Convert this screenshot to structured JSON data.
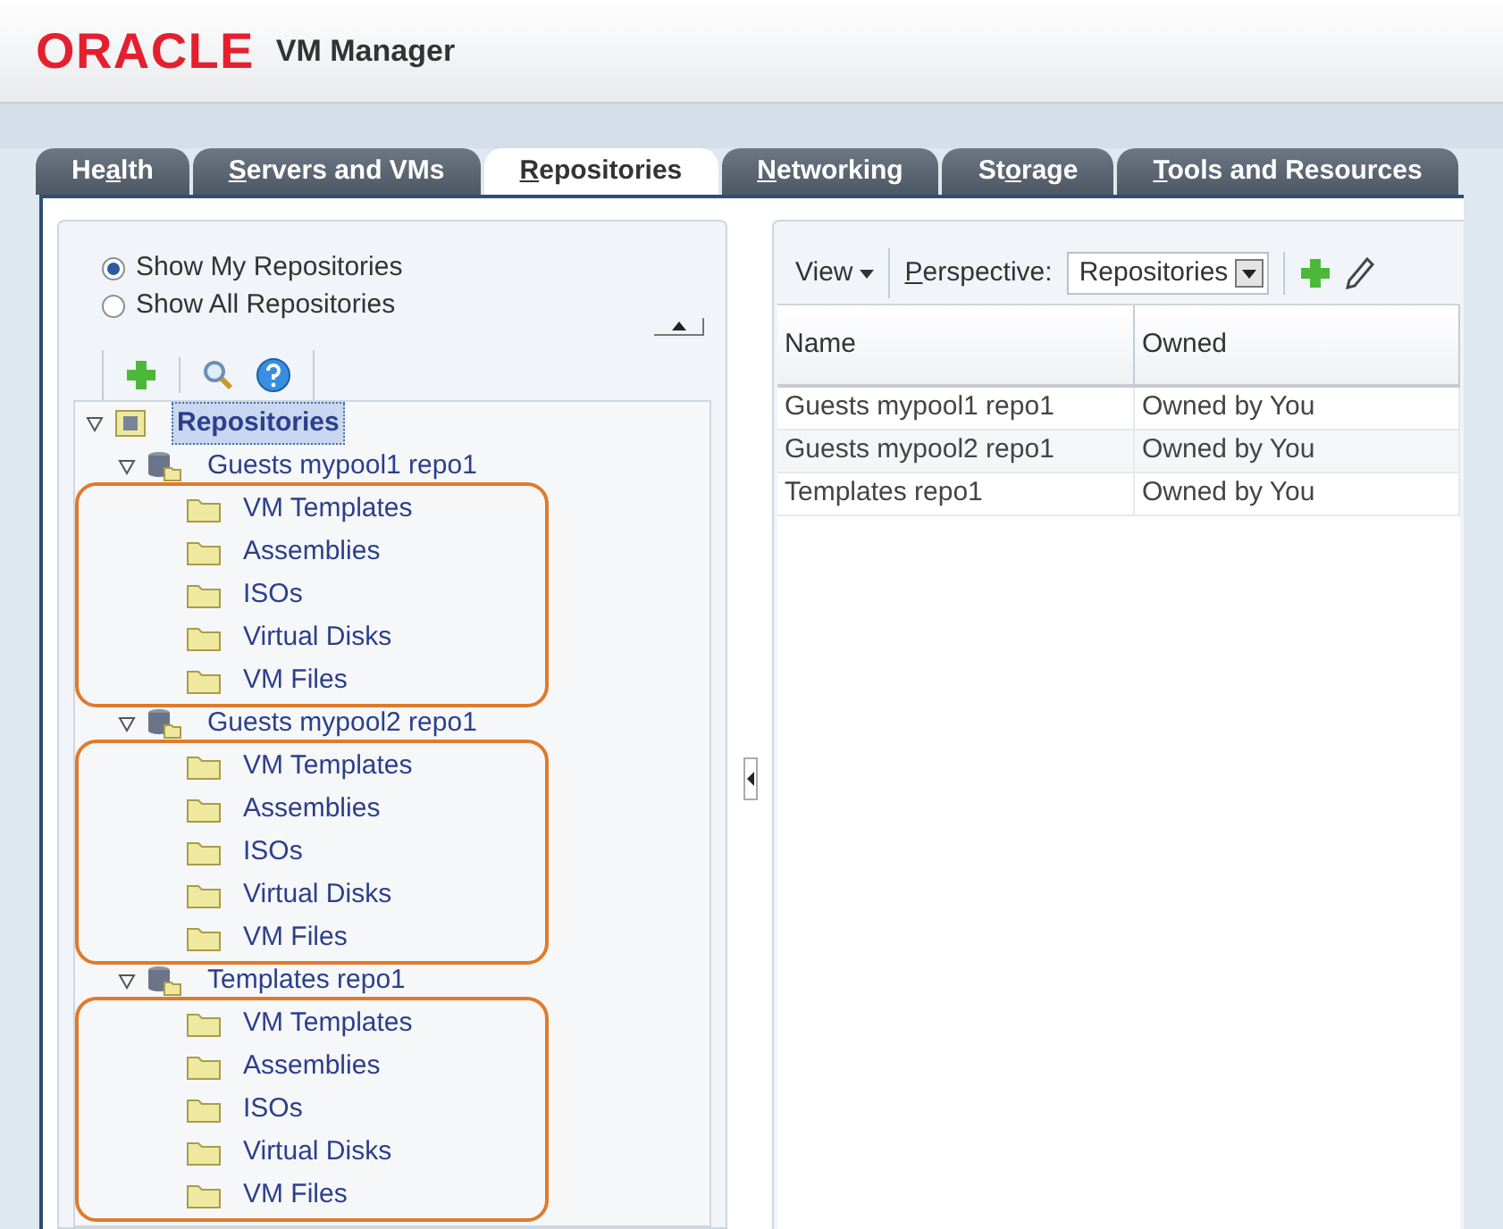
{
  "header": {
    "logo": "ORACLE",
    "title": "VM Manager"
  },
  "tabs": [
    {
      "label_parts": {
        "before": "He",
        "key": "a",
        "after": "lth"
      },
      "selected": false
    },
    {
      "label_parts": {
        "key": "S",
        "after": "ervers and VMs"
      },
      "selected": false
    },
    {
      "label_parts": {
        "key": "R",
        "after": "epositories"
      },
      "selected": true
    },
    {
      "label_parts": {
        "key": "N",
        "after": "etworking"
      },
      "selected": false
    },
    {
      "label_parts": {
        "before": "St",
        "key": "o",
        "after": "rage"
      },
      "selected": false
    },
    {
      "label_parts": {
        "key": "T",
        "after": "ools and Resources"
      },
      "selected": false
    }
  ],
  "left_panel": {
    "radios": [
      {
        "label": "Show My Repositories",
        "selected": true
      },
      {
        "label": "Show All Repositories",
        "selected": false
      }
    ],
    "tree": {
      "label": "Repositories",
      "expanded": true,
      "selected": true,
      "children": [
        {
          "label": "Guests mypool1 repo1",
          "expanded": true,
          "highlighted": true,
          "children": [
            {
              "label": "VM Templates"
            },
            {
              "label": "Assemblies"
            },
            {
              "label": "ISOs"
            },
            {
              "label": "Virtual Disks"
            },
            {
              "label": "VM Files"
            }
          ]
        },
        {
          "label": "Guests mypool2 repo1",
          "expanded": true,
          "highlighted": true,
          "children": [
            {
              "label": "VM Templates"
            },
            {
              "label": "Assemblies"
            },
            {
              "label": "ISOs"
            },
            {
              "label": "Virtual Disks"
            },
            {
              "label": "VM Files"
            }
          ]
        },
        {
          "label": "Templates repo1",
          "expanded": true,
          "highlighted": true,
          "children": [
            {
              "label": "VM Templates"
            },
            {
              "label": "Assemblies"
            },
            {
              "label": "ISOs"
            },
            {
              "label": "Virtual Disks"
            },
            {
              "label": "VM Files"
            }
          ]
        }
      ]
    }
  },
  "right_panel": {
    "view_menu": "View",
    "perspective_label_parts": {
      "key": "P",
      "after": "erspective:"
    },
    "perspective_value": "Repositories",
    "table": {
      "columns": [
        "Name",
        "Owned"
      ],
      "rows": [
        [
          "Guests mypool1 repo1",
          "Owned by You"
        ],
        [
          "Guests mypool2 repo1",
          "Owned by You"
        ],
        [
          "Templates repo1",
          "Owned by You"
        ]
      ]
    }
  }
}
